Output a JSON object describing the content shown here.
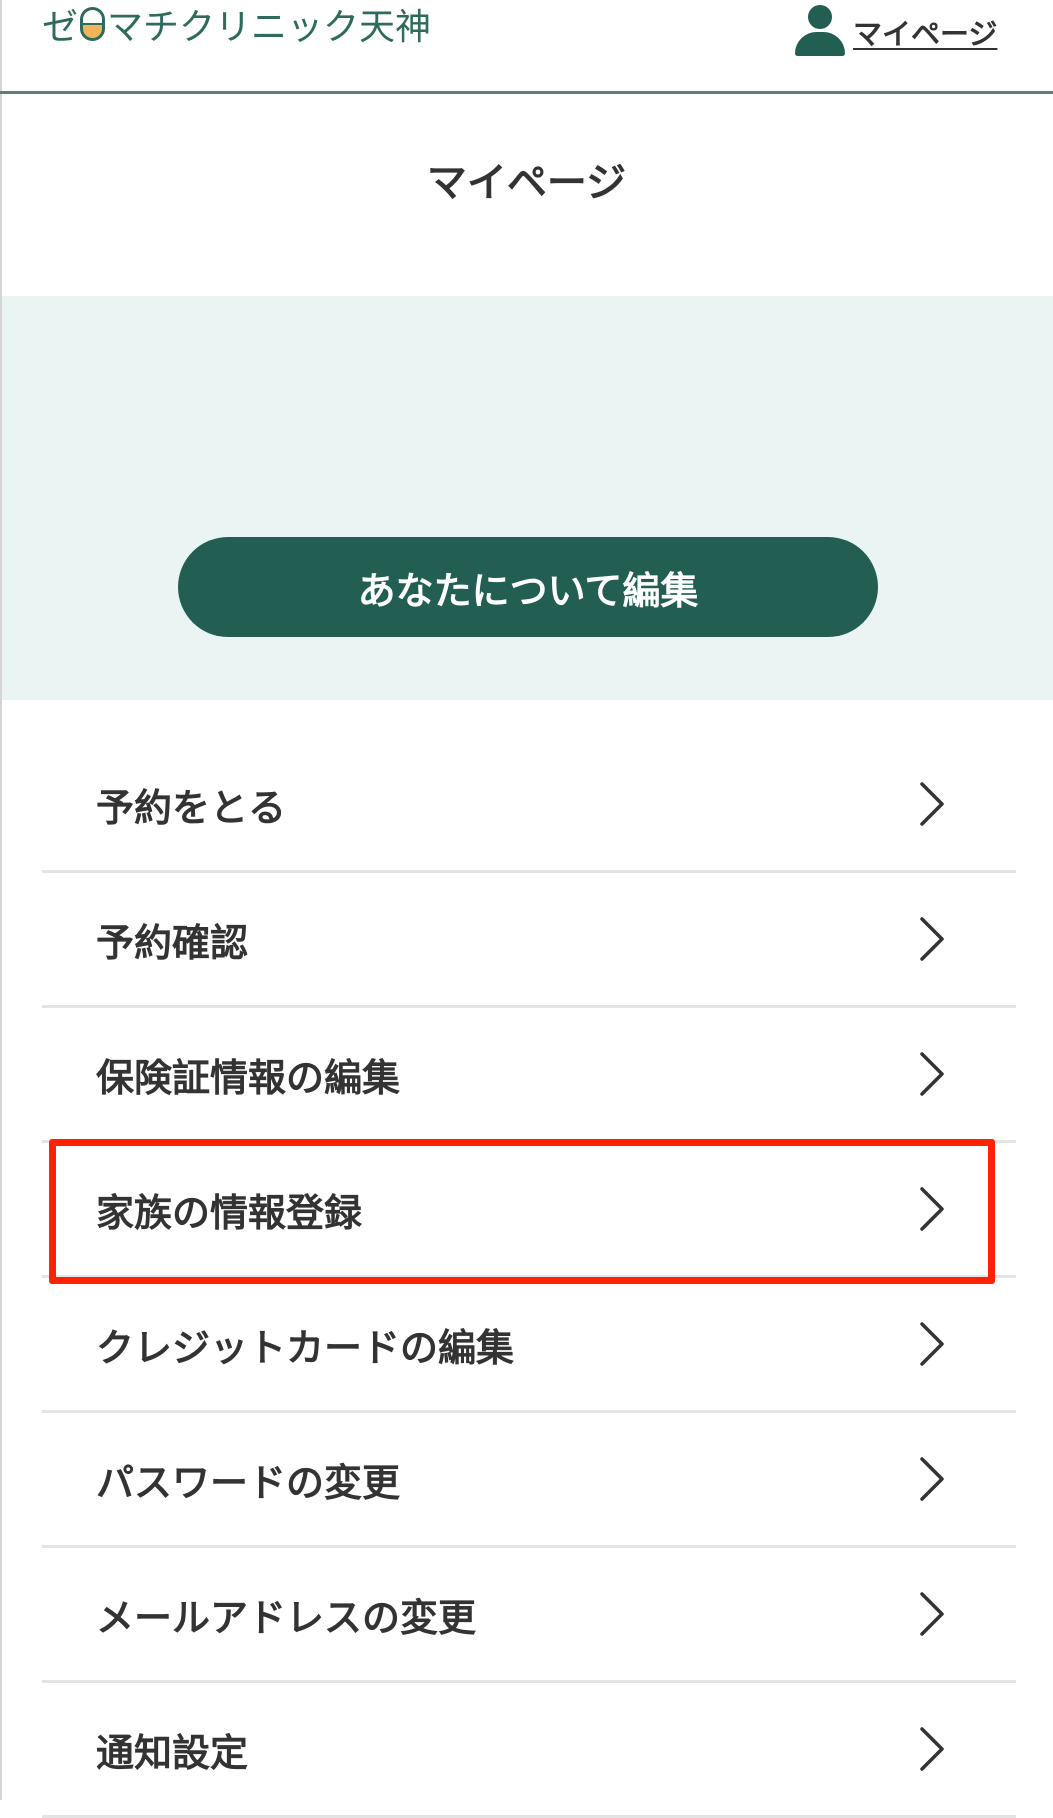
{
  "header": {
    "logo_prefix": "ゼ",
    "logo_suffix": "マチクリニック天神",
    "mypage_link": "マイページ"
  },
  "page": {
    "title": "マイページ"
  },
  "hero": {
    "edit_button": "あなたについて編集"
  },
  "menu": {
    "items": [
      {
        "label": "予約をとる"
      },
      {
        "label": "予約確認"
      },
      {
        "label": "保険証情報の編集"
      },
      {
        "label": "家族の情報登録",
        "highlighted": true
      },
      {
        "label": "クレジットカードの編集"
      },
      {
        "label": "パスワードの変更"
      },
      {
        "label": "メールアドレスの変更"
      },
      {
        "label": "通知設定"
      }
    ]
  },
  "colors": {
    "brand_green": "#225e52",
    "hero_background": "#eaf4f2",
    "highlight": "#ff2200"
  }
}
